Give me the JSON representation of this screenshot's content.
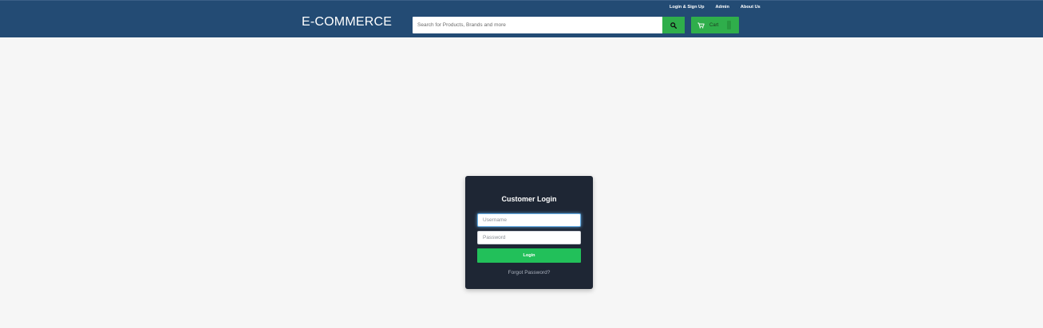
{
  "header": {
    "brand": "E-COMMERCE",
    "links": [
      "Login & Sign Up",
      "Admin",
      "About Us"
    ],
    "search": {
      "placeholder": "Search for Products, Brands and more",
      "value": "",
      "button_icon": "search-icon"
    },
    "cart": {
      "label": "Cart",
      "icon": "cart-icon"
    }
  },
  "login": {
    "title": "Customer Login",
    "username_placeholder": "Username",
    "password_placeholder": "Password",
    "button_label": "Login",
    "forgot_link": "Forgot Password?"
  },
  "colors": {
    "header_bg": "#234b74",
    "accent_green": "#2fae4b",
    "login_btn": "#22c05a",
    "login_panel": "#1e2634",
    "page_bg": "#f6f6f6"
  }
}
